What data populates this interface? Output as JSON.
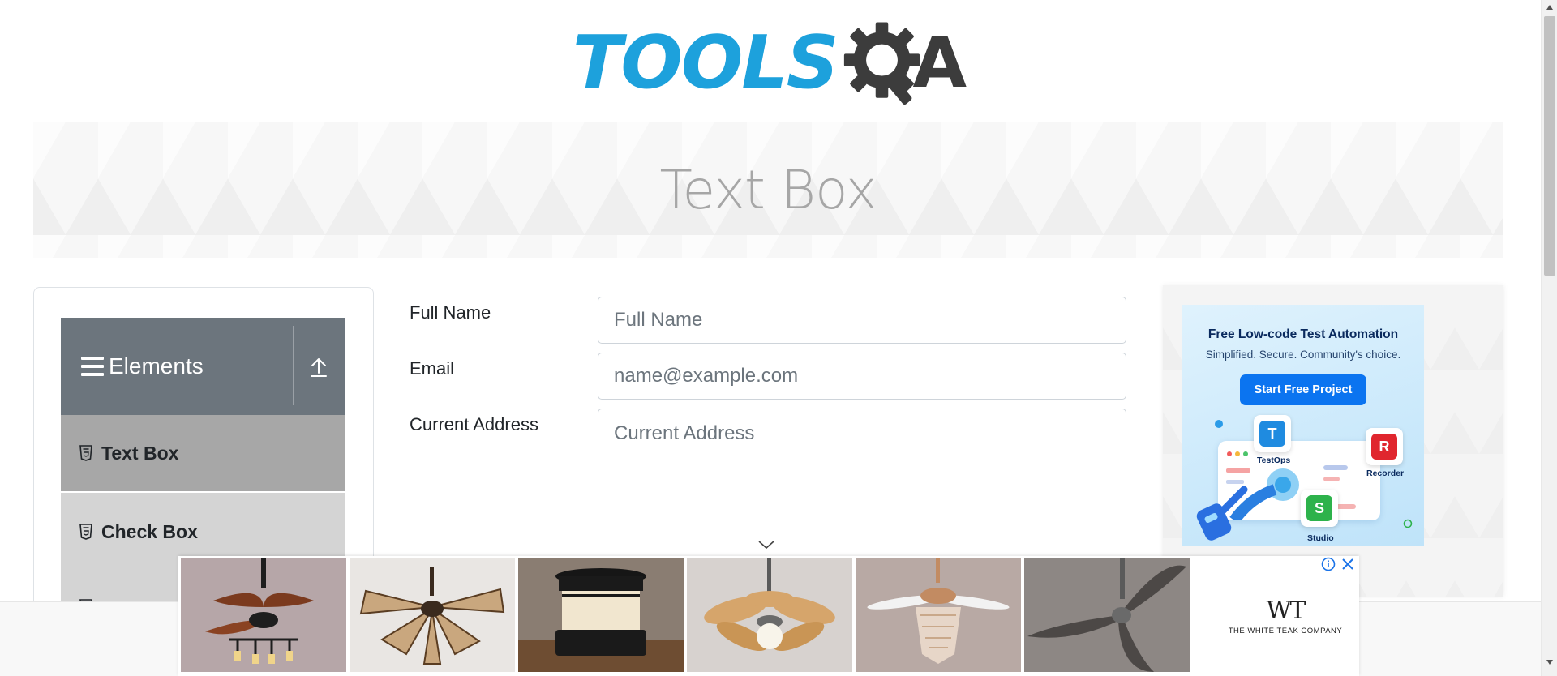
{
  "logo": {
    "text_tools": "TOOLS",
    "text_a": "A",
    "colors": {
      "tools": "#1da1dc",
      "gear": "#3c3c3c"
    }
  },
  "banner": {
    "title": "Text Box"
  },
  "sidebar": {
    "group_title": "Elements",
    "items": [
      {
        "label": "Text Box",
        "icon": "html5-icon",
        "active": true
      },
      {
        "label": "Check Box",
        "icon": "html5-icon",
        "active": false
      },
      {
        "label": "",
        "icon": "html5-icon",
        "active": false
      }
    ]
  },
  "form": {
    "full_name": {
      "label": "Full Name",
      "placeholder": "Full Name",
      "value": ""
    },
    "email": {
      "label": "Email",
      "placeholder": "name@example.com",
      "value": ""
    },
    "current_address": {
      "label": "Current Address",
      "placeholder": "Current Address",
      "value": ""
    }
  },
  "right_ad": {
    "title": "Free Low-code Test Automation",
    "subtitle": "Simplified. Secure. Community's choice.",
    "button": "Start Free Project",
    "tiles": [
      {
        "letter": "T",
        "caption": "TestOps",
        "color": "#1f8be0"
      },
      {
        "letter": "R",
        "caption": "Recorder",
        "color": "#e0262e"
      },
      {
        "letter": "S",
        "caption": "Studio",
        "color": "#2db24b"
      }
    ]
  },
  "bottom_ad": {
    "products": [
      "ceiling-fan-chandelier",
      "ceiling-fan-wicker",
      "outdoor-lamp",
      "ceiling-fan-wood",
      "crystal-fan-chandelier",
      "ceiling-fan-dark"
    ],
    "brand_mark": "WT",
    "brand_name": "THE WHITE TEAK COMPANY"
  }
}
